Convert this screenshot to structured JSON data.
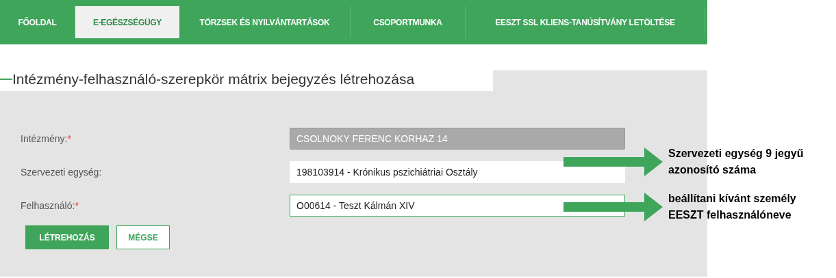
{
  "nav": {
    "tabs": [
      {
        "label": "FŐOLDAL",
        "selected": false
      },
      {
        "label": "E-EGÉSZSÉGÜGY",
        "selected": true
      },
      {
        "label": "TÖRZSEK ÉS NYILVÁNTARTÁSOK",
        "selected": false
      },
      {
        "label": "CSOPORTMUNKA",
        "selected": false
      },
      {
        "label": "EESZT SSL KLIENS-TANÚSÍTVÁNY LETÖLTÉSE",
        "selected": false
      }
    ]
  },
  "page_title": "Intézmény-felhasználó-szerepkör mátrix bejegyzés létrehozása",
  "form": {
    "fields": [
      {
        "label": "Intézmény:",
        "required_mark": "*",
        "value": "CSOLNOKY FERENC KORHAZ 14",
        "disabled": true,
        "focused": false
      },
      {
        "label": "Szervezeti egység:",
        "value": "198103914 - Krónikus pszichiátriai Osztály",
        "disabled": false,
        "focused": false
      },
      {
        "label": "Felhasználó:",
        "required_mark": "*",
        "value": "O00614 - Teszt Kálmán XIV",
        "disabled": false,
        "focused": true
      }
    ],
    "buttons": [
      {
        "label": "LÉTREHOZÁS",
        "kind": "primary"
      },
      {
        "label": "MÉGSE",
        "kind": "secondary"
      }
    ]
  },
  "annotations": [
    {
      "lines": [
        "Szervezeti egység 9 jegyű",
        "azonosító száma"
      ]
    },
    {
      "lines": [
        "beállítani kívánt személy",
        "EESZT felhasználóneve"
      ]
    }
  ]
}
